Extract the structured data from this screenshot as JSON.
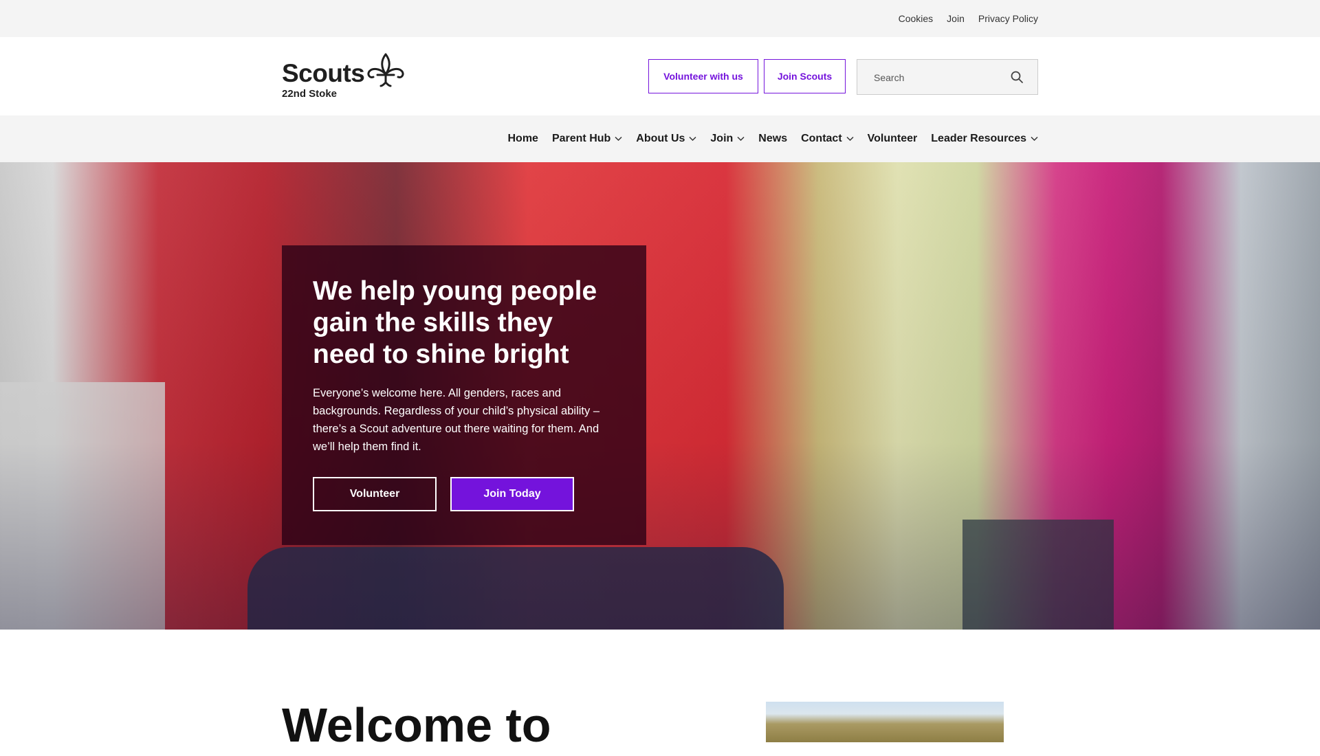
{
  "utility": {
    "links": [
      "Cookies",
      "Join",
      "Privacy Policy"
    ]
  },
  "header": {
    "logo": {
      "word": "Scouts",
      "subtitle": "22nd Stoke",
      "icon": "fleur-de-lis-icon"
    },
    "volunteer_button": "Volunteer with us",
    "join_button": "Join Scouts",
    "search": {
      "placeholder": "Search",
      "icon": "search-icon"
    }
  },
  "nav": {
    "items": [
      {
        "label": "Home",
        "dropdown": false
      },
      {
        "label": "Parent Hub",
        "dropdown": true
      },
      {
        "label": "About Us",
        "dropdown": true
      },
      {
        "label": "Join",
        "dropdown": true
      },
      {
        "label": "News",
        "dropdown": false
      },
      {
        "label": "Contact",
        "dropdown": true
      },
      {
        "label": "Volunteer",
        "dropdown": false
      },
      {
        "label": "Leader Resources",
        "dropdown": true
      }
    ]
  },
  "hero": {
    "title": "We help young people gain the skills they need to shine bright",
    "text": "Everyone’s welcome here. All genders, races and backgrounds. Regardless of your child’s physical ability – there’s a Scout adventure out there waiting for them. And we’ll help them find it.",
    "volunteer_button": "Volunteer",
    "join_button": "Join Today"
  },
  "welcome": {
    "heading": "Welcome to"
  },
  "colors": {
    "accent": "#7413dc",
    "panel": "#280014"
  }
}
